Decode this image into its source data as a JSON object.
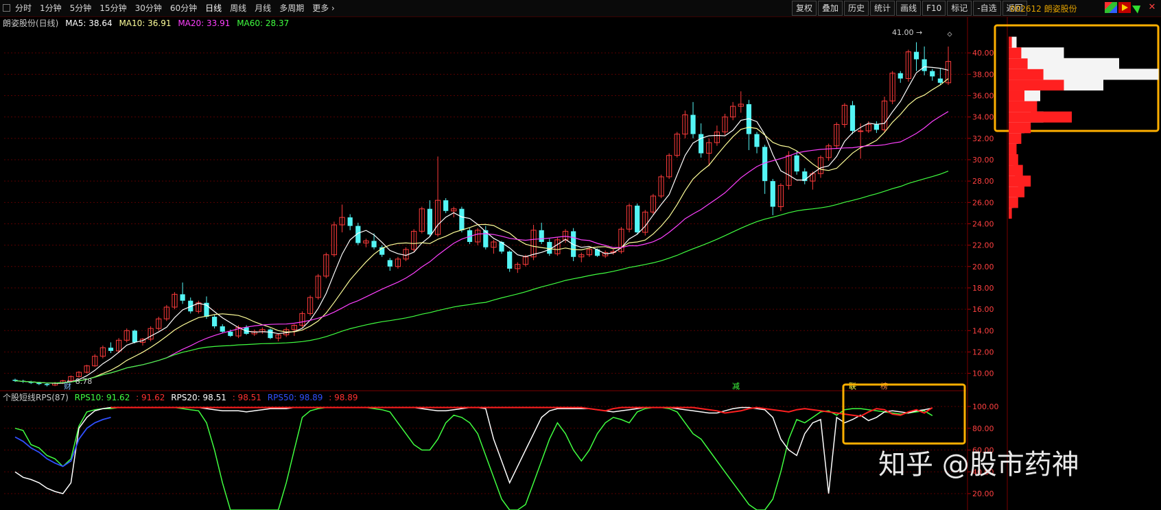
{
  "toolbar": {
    "periods": [
      "分时",
      "1分钟",
      "5分钟",
      "15分钟",
      "30分钟",
      "60分钟",
      "日线",
      "周线",
      "月线",
      "多周期",
      "更多"
    ],
    "active_period": "日线",
    "right_buttons": [
      "复权",
      "叠加",
      "历史",
      "统计",
      "画线",
      "F10",
      "标记",
      "-自选",
      "返回"
    ]
  },
  "stock": {
    "code_name": "002612 朗姿股份"
  },
  "legend": {
    "title": "朗姿股份(日线)",
    "ma5": "MA5: 38.64",
    "ma10": "MA10: 36.91",
    "ma20": "MA20: 33.91",
    "ma60": "MA60: 28.37"
  },
  "rps_legend": {
    "title": "个股短线RPS(87)",
    "rps10": "RPS10: 91.62",
    "rps10b": ": 91.62",
    "rps20": "RPS20: 98.51",
    "rps20b": ": 98.51",
    "rps50": "RPS50: 98.89",
    "rps50b": ": 98.89"
  },
  "annotations": {
    "high": "41.00",
    "low": "8.78",
    "cai": "财",
    "jian": "减",
    "lian": "联",
    "bang": "榜"
  },
  "watermark": "知乎 @股市药神",
  "colors": {
    "up": "#ff3b3b",
    "down": "#54f5f5",
    "ma5": "#ffffff",
    "ma10": "#ffff9a",
    "ma20": "#ff40ff",
    "ma60": "#40ff40",
    "highlight": "#ffb000"
  },
  "chart_data": [
    {
      "type": "candlestick",
      "title": "朗姿股份(日线)",
      "y_ticks": [
        "10.00",
        "12.00",
        "14.00",
        "16.00",
        "18.00",
        "20.00",
        "22.00",
        "24.00",
        "26.00",
        "28.00",
        "30.00",
        "32.00",
        "34.00",
        "36.00",
        "38.00",
        "40.00"
      ],
      "ylim": [
        8.5,
        42
      ],
      "ohlc": [
        [
          9.4,
          9.5,
          9.2,
          9.3
        ],
        [
          9.3,
          9.4,
          9.1,
          9.2
        ],
        [
          9.2,
          9.3,
          9.0,
          9.1
        ],
        [
          9.1,
          9.2,
          8.9,
          9.0
        ],
        [
          9.0,
          9.1,
          8.78,
          8.9
        ],
        [
          8.9,
          9.2,
          8.8,
          9.1
        ],
        [
          9.1,
          9.4,
          9.0,
          9.3
        ],
        [
          9.3,
          9.8,
          9.2,
          9.7
        ],
        [
          9.7,
          10.2,
          9.6,
          10.1
        ],
        [
          10.1,
          10.8,
          10.0,
          10.7
        ],
        [
          10.7,
          11.8,
          10.6,
          11.6
        ],
        [
          11.6,
          12.6,
          11.4,
          12.4
        ],
        [
          12.4,
          12.9,
          11.9,
          12.1
        ],
        [
          12.1,
          13.3,
          11.9,
          13.1
        ],
        [
          13.1,
          14.2,
          12.9,
          14.0
        ],
        [
          14.0,
          14.1,
          12.8,
          12.9
        ],
        [
          12.9,
          13.3,
          12.6,
          13.2
        ],
        [
          13.2,
          14.4,
          13.0,
          14.2
        ],
        [
          14.2,
          15.3,
          14.0,
          15.1
        ],
        [
          15.1,
          16.4,
          14.9,
          16.2
        ],
        [
          16.2,
          17.6,
          16.0,
          17.4
        ],
        [
          17.4,
          18.5,
          16.5,
          16.8
        ],
        [
          16.8,
          17.1,
          15.6,
          15.8
        ],
        [
          15.8,
          16.8,
          15.6,
          16.6
        ],
        [
          16.6,
          17.2,
          15.1,
          15.3
        ],
        [
          15.3,
          15.5,
          14.2,
          14.4
        ],
        [
          14.4,
          14.6,
          13.8,
          13.9
        ],
        [
          13.9,
          14.1,
          13.4,
          13.5
        ],
        [
          13.5,
          14.5,
          13.3,
          14.3
        ],
        [
          14.3,
          14.5,
          13.6,
          13.7
        ],
        [
          13.7,
          14.1,
          13.5,
          13.9
        ],
        [
          13.9,
          14.3,
          13.7,
          14.1
        ],
        [
          14.1,
          14.2,
          13.2,
          13.3
        ],
        [
          13.3,
          13.7,
          13.0,
          13.6
        ],
        [
          13.6,
          14.3,
          13.4,
          14.1
        ],
        [
          14.1,
          14.6,
          13.5,
          14.5
        ],
        [
          14.5,
          15.8,
          14.3,
          15.6
        ],
        [
          15.6,
          17.3,
          15.4,
          17.1
        ],
        [
          17.1,
          19.3,
          16.9,
          19.1
        ],
        [
          19.1,
          21.3,
          18.9,
          21.1
        ],
        [
          21.1,
          24.2,
          20.9,
          23.9
        ],
        [
          23.9,
          25.8,
          23.2,
          24.6
        ],
        [
          24.6,
          24.9,
          23.4,
          23.8
        ],
        [
          23.8,
          24.1,
          22.0,
          22.2
        ],
        [
          22.2,
          22.6,
          21.8,
          22.4
        ],
        [
          22.4,
          23.1,
          21.6,
          21.8
        ],
        [
          21.8,
          22.0,
          20.9,
          21.1
        ],
        [
          20.6,
          20.8,
          19.6,
          20.0
        ],
        [
          20.0,
          20.9,
          19.8,
          20.7
        ],
        [
          20.7,
          21.8,
          20.5,
          21.6
        ],
        [
          21.6,
          23.5,
          21.4,
          23.3
        ],
        [
          23.3,
          25.6,
          23.1,
          25.4
        ],
        [
          25.4,
          26.2,
          22.8,
          23.0
        ],
        [
          23.0,
          30.3,
          22.8,
          26.2
        ],
        [
          26.2,
          26.4,
          25.0,
          25.2
        ],
        [
          25.2,
          25.6,
          24.6,
          25.4
        ],
        [
          25.4,
          25.6,
          23.2,
          23.4
        ],
        [
          23.4,
          23.6,
          22.1,
          22.3
        ],
        [
          22.3,
          23.6,
          22.0,
          23.4
        ],
        [
          23.4,
          23.8,
          21.6,
          21.8
        ],
        [
          21.8,
          22.5,
          21.2,
          22.3
        ],
        [
          22.3,
          22.4,
          21.2,
          21.4
        ],
        [
          21.4,
          21.5,
          19.5,
          19.8
        ],
        [
          19.8,
          20.4,
          19.4,
          20.2
        ],
        [
          20.2,
          21.1,
          20.0,
          20.9
        ],
        [
          20.9,
          23.9,
          20.6,
          23.4
        ],
        [
          23.4,
          24.1,
          22.1,
          22.3
        ],
        [
          22.3,
          22.6,
          21.0,
          21.2
        ],
        [
          21.2,
          22.7,
          21.0,
          22.5
        ],
        [
          22.5,
          23.5,
          22.2,
          23.3
        ],
        [
          23.3,
          23.6,
          20.5,
          20.9
        ],
        [
          20.9,
          21.3,
          20.4,
          21.1
        ],
        [
          21.1,
          21.8,
          20.9,
          21.6
        ],
        [
          21.6,
          21.7,
          20.9,
          21.0
        ],
        [
          21.0,
          21.5,
          20.8,
          21.3
        ],
        [
          21.3,
          21.6,
          21.1,
          21.4
        ],
        [
          21.4,
          23.7,
          21.2,
          23.5
        ],
        [
          23.5,
          25.9,
          23.2,
          25.7
        ],
        [
          25.7,
          25.9,
          23.0,
          23.2
        ],
        [
          23.2,
          25.3,
          22.9,
          25.1
        ],
        [
          25.1,
          26.8,
          24.9,
          26.6
        ],
        [
          26.6,
          28.6,
          26.4,
          28.4
        ],
        [
          28.4,
          30.6,
          28.2,
          30.4
        ],
        [
          30.4,
          32.6,
          30.2,
          32.4
        ],
        [
          32.4,
          34.6,
          32.0,
          34.2
        ],
        [
          34.2,
          35.4,
          32.0,
          32.4
        ],
        [
          32.4,
          33.4,
          30.2,
          30.6
        ],
        [
          30.6,
          32.0,
          29.4,
          31.6
        ],
        [
          31.6,
          33.2,
          31.3,
          32.6
        ],
        [
          32.6,
          34.3,
          32.3,
          34.0
        ],
        [
          34.0,
          35.4,
          33.7,
          35.0
        ],
        [
          35.0,
          36.4,
          34.4,
          35.2
        ],
        [
          35.2,
          35.6,
          30.9,
          32.4
        ],
        [
          32.4,
          32.6,
          30.6,
          31.2
        ],
        [
          31.2,
          31.4,
          26.8,
          28.0
        ],
        [
          28.0,
          28.2,
          24.8,
          25.6
        ],
        [
          25.6,
          27.8,
          25.2,
          27.6
        ],
        [
          27.6,
          30.8,
          27.2,
          30.4
        ],
        [
          30.4,
          30.8,
          28.6,
          28.9
        ],
        [
          28.9,
          29.2,
          27.7,
          28.0
        ],
        [
          28.0,
          28.9,
          27.2,
          28.7
        ],
        [
          28.7,
          30.4,
          28.3,
          30.2
        ],
        [
          30.2,
          31.5,
          29.9,
          31.3
        ],
        [
          31.3,
          33.5,
          31.0,
          33.3
        ],
        [
          33.3,
          35.3,
          33.0,
          35.1
        ],
        [
          35.1,
          35.5,
          32.4,
          32.7
        ],
        [
          32.7,
          33.4,
          30.1,
          32.7
        ],
        [
          32.7,
          33.6,
          32.5,
          33.3
        ],
        [
          33.3,
          33.6,
          32.5,
          32.8
        ],
        [
          32.8,
          35.9,
          32.6,
          35.5
        ],
        [
          35.5,
          38.3,
          35.2,
          38.1
        ],
        [
          38.1,
          38.3,
          37.2,
          37.6
        ],
        [
          37.6,
          40.3,
          37.3,
          40.1
        ],
        [
          40.1,
          41.0,
          38.3,
          39.4
        ],
        [
          39.4,
          40.6,
          37.9,
          38.3
        ],
        [
          38.3,
          38.5,
          37.4,
          37.8
        ],
        [
          37.6,
          38.6,
          37.0,
          37.2
        ],
        [
          37.2,
          40.6,
          37.0,
          39.2
        ]
      ],
      "ma_names": [
        "MA5",
        "MA10",
        "MA20",
        "MA60"
      ]
    },
    {
      "type": "line",
      "title": "个股短线RPS(87)",
      "y_ticks": [
        "20.00",
        "40.00",
        "60.00",
        "80.00",
        "100.00"
      ],
      "ylim": [
        5,
        105
      ],
      "series": [
        {
          "name": "RPS10",
          "values": [
            80,
            78,
            65,
            62,
            55,
            52,
            45,
            52,
            82,
            95,
            97,
            98,
            98,
            99,
            99,
            99,
            99,
            99,
            99,
            99,
            99,
            98,
            97,
            96,
            85,
            60,
            30,
            5,
            5,
            5,
            5,
            5,
            5,
            5,
            30,
            60,
            90,
            96,
            98,
            99,
            99,
            99,
            99,
            99,
            99,
            98,
            97,
            95,
            85,
            75,
            65,
            60,
            60,
            70,
            85,
            92,
            90,
            85,
            75,
            55,
            35,
            15,
            5,
            5,
            10,
            30,
            50,
            70,
            85,
            75,
            60,
            50,
            60,
            75,
            85,
            90,
            88,
            85,
            95,
            98,
            99,
            99,
            98,
            95,
            85,
            75,
            70,
            60,
            50,
            40,
            30,
            20,
            10,
            5,
            5,
            15,
            40,
            70,
            88,
            85,
            90,
            95,
            96,
            92,
            97,
            98,
            98,
            97,
            96,
            95,
            94,
            93,
            94,
            95,
            96,
            91.62
          ]
        },
        {
          "name": "RPS20",
          "values": [
            40,
            35,
            33,
            30,
            25,
            22,
            20,
            30,
            80,
            90,
            96,
            98,
            99,
            99,
            99,
            99,
            99,
            99,
            99,
            99,
            99,
            99,
            99,
            99,
            98,
            97,
            96,
            96,
            96,
            95,
            96,
            97,
            98,
            98,
            98,
            99,
            99,
            99,
            99,
            99,
            99,
            99,
            99,
            99,
            99,
            99,
            99,
            99,
            99,
            99,
            99,
            98,
            97,
            96,
            96,
            97,
            98,
            99,
            99,
            98,
            70,
            50,
            30,
            45,
            60,
            75,
            90,
            96,
            98,
            98,
            98,
            98,
            98,
            97,
            96,
            95,
            96,
            97,
            98,
            99,
            99,
            99,
            99,
            98,
            97,
            96,
            95,
            94,
            94,
            96,
            98,
            99,
            99,
            98,
            97,
            90,
            70,
            60,
            55,
            75,
            85,
            88,
            20,
            90,
            85,
            88,
            92,
            87,
            90,
            95,
            96,
            95,
            94,
            96,
            97,
            98.51
          ]
        },
        {
          "name": "RPS50",
          "values": [
            72,
            68,
            62,
            58,
            52,
            48,
            45,
            50,
            70,
            80,
            85,
            88,
            90
          ]
        }
      ],
      "ref": {
        "name": "RPS10-red",
        "values": [
          95,
          96,
          97,
          98,
          99,
          99,
          99,
          99,
          99,
          99,
          99,
          99,
          99,
          99,
          99,
          99,
          99,
          99,
          99,
          99,
          99,
          99,
          99,
          99,
          99,
          99,
          99,
          99,
          99,
          99,
          99,
          99,
          99,
          99,
          99,
          99,
          99,
          99,
          99,
          99,
          99,
          99,
          99,
          99,
          99,
          99,
          99,
          99,
          99,
          99,
          99,
          99,
          99,
          99,
          99,
          99,
          99,
          99,
          99,
          99,
          99,
          99,
          99,
          99,
          99,
          99,
          99,
          99,
          99,
          99,
          99,
          99,
          98,
          97,
          96,
          98,
          99,
          99,
          99,
          99,
          99,
          99,
          99,
          99,
          99,
          99,
          98,
          97,
          96,
          94,
          95,
          96,
          98,
          99,
          98,
          97,
          96,
          95,
          97,
          98,
          97,
          96,
          95,
          94,
          93,
          92,
          91,
          95,
          98,
          97,
          93,
          92,
          95,
          97,
          94,
          98.89
        ]
      }
    },
    {
      "type": "bar",
      "title": "",
      "note": "chip distribution profile",
      "price_levels": [
        25,
        26,
        27,
        28,
        29,
        30,
        31,
        32,
        33,
        34,
        35,
        36,
        37,
        38,
        39,
        40,
        41
      ],
      "red_values": [
        2,
        6,
        10,
        14,
        9,
        6,
        5,
        8,
        14,
        40,
        18,
        10,
        35,
        22,
        12,
        8,
        2
      ],
      "white_values": [
        1,
        3,
        5,
        6,
        4,
        3,
        4,
        6,
        10,
        22,
        14,
        20,
        60,
        95,
        70,
        35,
        5
      ]
    }
  ]
}
